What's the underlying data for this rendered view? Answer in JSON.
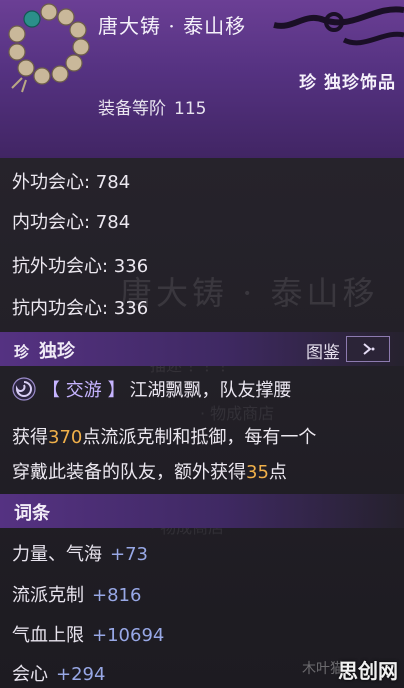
{
  "item": {
    "name": "唐大铸 · 泰山移",
    "rarity": "珍 独珍饰品",
    "level_label": "装备等阶",
    "level_value": "115"
  },
  "base_stats": [
    {
      "label": "外功会心",
      "value": "784"
    },
    {
      "label": "内功会心",
      "value": "784"
    },
    {
      "label": "抗外功会心",
      "value": "336"
    },
    {
      "label": "抗内功会心",
      "value": "336"
    }
  ],
  "unique_section": {
    "mark": "珍",
    "title": "独珍",
    "codex_label": "图鉴",
    "codex_icon": "chevron-right-icon"
  },
  "skill": {
    "icon": "swirl-icon",
    "tag": "【 交游 】",
    "name": "江湖飘飘，队友撑腰",
    "desc_line1_pre": "获得",
    "desc_line1_num": "370",
    "desc_line1_post": "点流派克制和抵御，每有一个",
    "desc_line2_pre": "穿戴此装备的队友，额外获得",
    "desc_line2_num": "35",
    "desc_line2_post": "点"
  },
  "affix_section": {
    "title": "词条"
  },
  "affixes": [
    {
      "label": "力量、气海",
      "value": "+73"
    },
    {
      "label": "流派克制",
      "value": "+816"
    },
    {
      "label": "气血上限",
      "value": "+10694"
    },
    {
      "label": "会心",
      "value": "+294"
    }
  ],
  "background_ghost": {
    "name": "唐大铸 · 泰山移",
    "line2": "描述 ？？？",
    "line3": "· 物成商店",
    "line4": "· 物成商店"
  },
  "watermark": {
    "text": "思创网",
    "faint": "木叶猫"
  },
  "colors": {
    "header_purple": "#5a3487",
    "highlight_orange": "#f0b04a",
    "value_blue": "#98a8e6",
    "skill_tag_violet": "#c6b4ff"
  }
}
